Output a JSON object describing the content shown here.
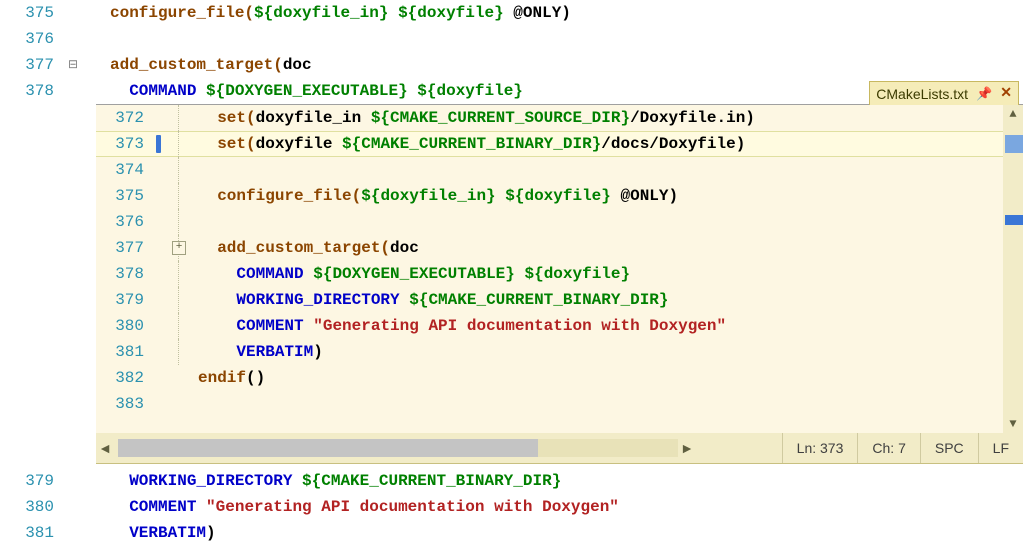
{
  "tab": {
    "title": "CMakeLists.txt",
    "pin_icon": "pin",
    "close_icon": "close"
  },
  "status": {
    "ln_label": "Ln:",
    "ln": "373",
    "ch_label": "Ch:",
    "ch": "7",
    "spaces": "SPC",
    "eol": "LF"
  },
  "bg": {
    "l375": {
      "n": "375",
      "a": "configure_file(",
      "b": "${doxyfile_in}",
      "c": " ",
      "d": "${doxyfile}",
      "e": " @ONLY)"
    },
    "l376": {
      "n": "376"
    },
    "l377": {
      "n": "377",
      "a": "add_custom_target(",
      "b": "doc"
    },
    "l378": {
      "n": "378",
      "a": "COMMAND",
      "b": " ",
      "c": "${DOXYGEN_EXECUTABLE}",
      "d": " ",
      "e": "${doxyfile}"
    },
    "l379": {
      "n": "379",
      "a": "WORKING_DIRECTORY",
      "b": " ",
      "c": "${CMAKE_CURRENT_BINARY_DIR}"
    },
    "l380": {
      "n": "380",
      "a": "COMMENT",
      "b": " ",
      "c": "\"Generating API documentation with Doxygen\""
    },
    "l381": {
      "n": "381",
      "a": "VERBATIM",
      "b": ")"
    }
  },
  "peek": {
    "l372": {
      "n": "372",
      "a": "set(",
      "b": "doxyfile_in ",
      "c": "${CMAKE_CURRENT_SOURCE_DIR}",
      "d": "/Doxyfile.in)"
    },
    "l373": {
      "n": "373",
      "a": "set(",
      "b": "doxyfile ",
      "c": "${CMAKE_CURRENT_BINARY_DIR}",
      "d": "/docs/Doxyfile)"
    },
    "l374": {
      "n": "374"
    },
    "l375": {
      "n": "375",
      "a": "configure_file(",
      "b": "${doxyfile_in}",
      "c": " ",
      "d": "${doxyfile}",
      "e": " @ONLY)"
    },
    "l376": {
      "n": "376"
    },
    "l377": {
      "n": "377",
      "a": "add_custom_target(",
      "b": "doc"
    },
    "l378": {
      "n": "378",
      "a": "COMMAND",
      "b": " ",
      "c": "${DOXYGEN_EXECUTABLE}",
      "d": " ",
      "e": "${doxyfile}"
    },
    "l379": {
      "n": "379",
      "a": "WORKING_DIRECTORY",
      "b": " ",
      "c": "${CMAKE_CURRENT_BINARY_DIR}"
    },
    "l380": {
      "n": "380",
      "a": "COMMENT",
      "b": " ",
      "c": "\"Generating API documentation with Doxygen\""
    },
    "l381": {
      "n": "381",
      "a": "VERBATIM",
      "b": ")"
    },
    "l382": {
      "n": "382",
      "a": "endif",
      "b": "()"
    },
    "l383": {
      "n": "383"
    }
  }
}
